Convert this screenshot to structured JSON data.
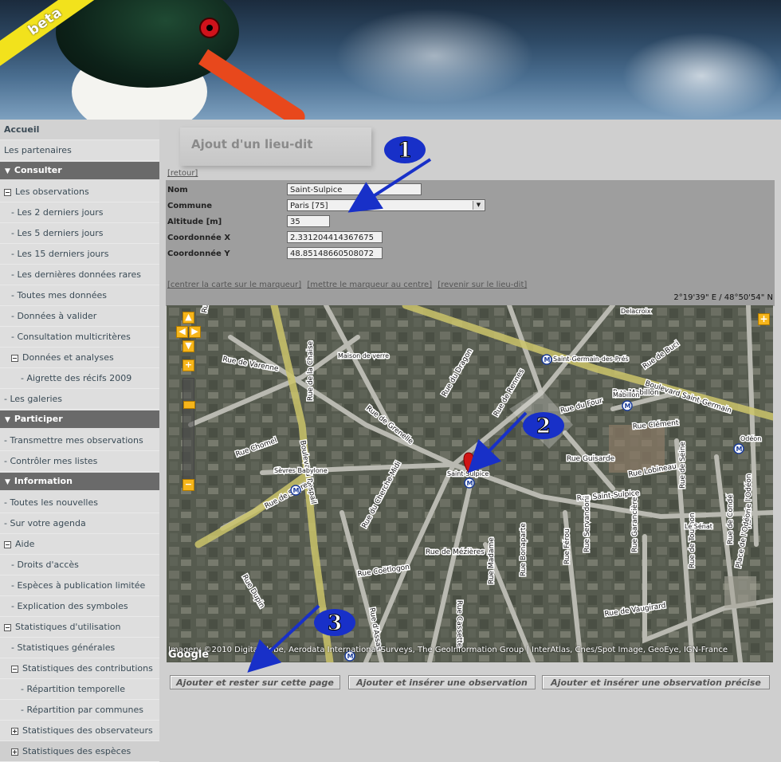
{
  "banner": {
    "beta_label": "beta"
  },
  "sidebar": {
    "items": [
      {
        "label": "Accueil",
        "level": 0,
        "kind": "first"
      },
      {
        "label": "Les partenaires",
        "level": 0
      },
      {
        "section": "Consulter"
      },
      {
        "label": "Les observations",
        "level": 0,
        "box": "minus"
      },
      {
        "label": "- Les 2 derniers jours",
        "level": 1
      },
      {
        "label": "- Les 5 derniers jours",
        "level": 1
      },
      {
        "label": "- Les 15 derniers jours",
        "level": 1
      },
      {
        "label": "- Les dernières données rares",
        "level": 1
      },
      {
        "label": "- Toutes mes données",
        "level": 1
      },
      {
        "label": "- Données à valider",
        "level": 1
      },
      {
        "label": "- Consultation multicritères",
        "level": 1
      },
      {
        "label": "Données et analyses",
        "level": 1,
        "box": "minus"
      },
      {
        "label": "- Aigrette des récifs 2009",
        "level": 2
      },
      {
        "label": "- Les galeries",
        "level": 0
      },
      {
        "section": "Participer"
      },
      {
        "label": "- Transmettre mes observations",
        "level": 0
      },
      {
        "label": "- Contrôler mes listes",
        "level": 0
      },
      {
        "section": "Information"
      },
      {
        "label": "- Toutes les nouvelles",
        "level": 0
      },
      {
        "label": "- Sur votre agenda",
        "level": 0
      },
      {
        "label": "Aide",
        "level": 0,
        "box": "minus"
      },
      {
        "label": "- Droits d'accès",
        "level": 1
      },
      {
        "label": "- Espèces à publication limitée",
        "level": 1
      },
      {
        "label": "- Explication des symboles",
        "level": 1
      },
      {
        "label": "Statistiques d'utilisation",
        "level": 0,
        "box": "minus"
      },
      {
        "label": "- Statistiques générales",
        "level": 1
      },
      {
        "label": "Statistiques des contributions",
        "level": 1,
        "box": "minus"
      },
      {
        "label": "- Répartition temporelle",
        "level": 2
      },
      {
        "label": "- Répartition par communes",
        "level": 2
      },
      {
        "label": "Statistiques des observateurs",
        "level": 1,
        "box": "plus"
      },
      {
        "label": "Statistiques des espèces",
        "level": 1,
        "box": "plus"
      }
    ]
  },
  "page": {
    "title": "Ajout d'un lieu-dit",
    "back_link": "[retour]"
  },
  "form": {
    "nom": {
      "label": "Nom",
      "value": "Saint-Sulpice"
    },
    "commune": {
      "label": "Commune",
      "value": "Paris [75]"
    },
    "altitude": {
      "label": "Altitude [m]",
      "value": "35"
    },
    "coord_x": {
      "label": "Coordonnée X",
      "value": "2.331204414367675"
    },
    "coord_y": {
      "label": "Coordonnée Y",
      "value": "48.85148660508072"
    }
  },
  "map_links": {
    "center": "[centrer la carte sur le marqueur]",
    "marker": "[mettre le marqueur au centre]",
    "back": "[revenir sur le lieu-dit]"
  },
  "map": {
    "coords": "2°19'39\" E / 48°50'54\" N",
    "copyright": "Imagery ©2010 DigitalGlobe, Aerodata International Surveys, The GeoInformation Group | InterAtlas, Cnes/Spot Image, GeoEye, IGN-France",
    "google_logo": "Google",
    "street_labels": [
      "Boulevard Raspail",
      "Rue de Sèvres",
      "Rue de Varenne",
      "Rue Chomel",
      "Rue de la Chaise",
      "Rue de Grenelle",
      "Rue du Dragon",
      "Rue de Rennes",
      "Rue du Cherche-Midi",
      "Rue du Four",
      "Rue Guisarde",
      "Rue Lobineau",
      "Rue Clément",
      "Boulevard Saint-Germain",
      "Rue de Buci",
      "Rue de Seine",
      "Rue Saint-Sulpice",
      "Rue de Tournon",
      "Rue de Condé",
      "Rue de l'Odéon",
      "Rue de Mézières",
      "Rue Coëtlogon",
      "Rue Cassette",
      "Rue Madame",
      "Rue Bonaparte",
      "Rue Férou",
      "Rue Servandoni",
      "Rue Garancière",
      "Rue de Vaugirard",
      "Rue Dupin",
      "Rue d'Assas",
      "Rue du Bac",
      "Place de l'Odéon",
      "Rue Mabillon"
    ],
    "place_labels": [
      "Maison de verre",
      "Delacroix",
      "Saint-Germain-des-Prés",
      "Mabillon",
      "Odéon",
      "Sèvres Babylone",
      "Saint-Sulpice",
      "Le Sénat"
    ],
    "annotations": [
      "1",
      "2",
      "3"
    ]
  },
  "buttons": {
    "stay": "Ajouter et rester sur cette page",
    "insert": "Ajouter et insérer une observation",
    "insert_precise": "Ajouter et insérer une observation précise"
  }
}
